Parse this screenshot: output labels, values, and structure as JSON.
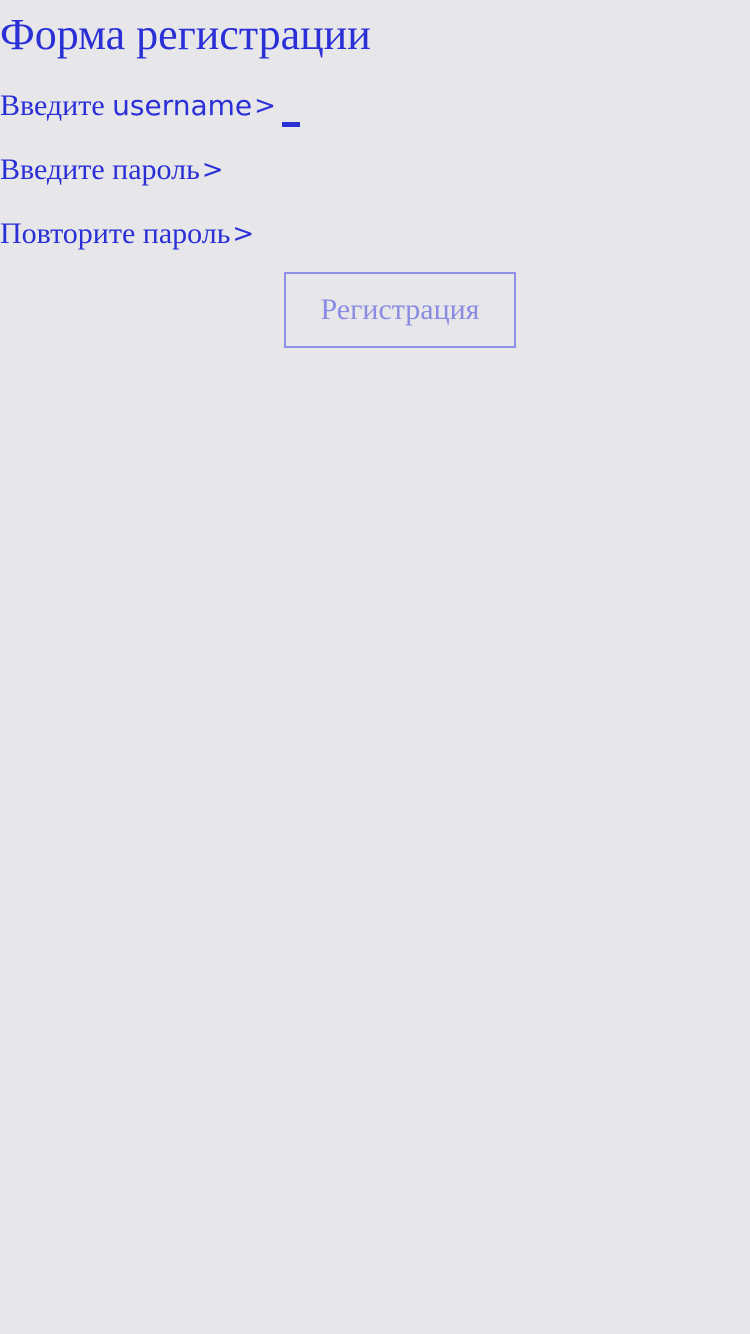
{
  "form": {
    "title": "Форма регистрации",
    "username": {
      "label_prefix": "Введите ",
      "label_latin": "username",
      "prompt": ">",
      "value": ""
    },
    "password": {
      "label": "Введите пароль",
      "prompt": ">",
      "value": ""
    },
    "repeat_password": {
      "label": "Повторите пароль",
      "prompt": ">",
      "value": ""
    },
    "submit_label": "Регистрация"
  },
  "colors": {
    "background": "#e7e7e9",
    "text": "#2b2fd6",
    "button_border": "#8e90e6",
    "button_text": "#8a8ce4"
  }
}
